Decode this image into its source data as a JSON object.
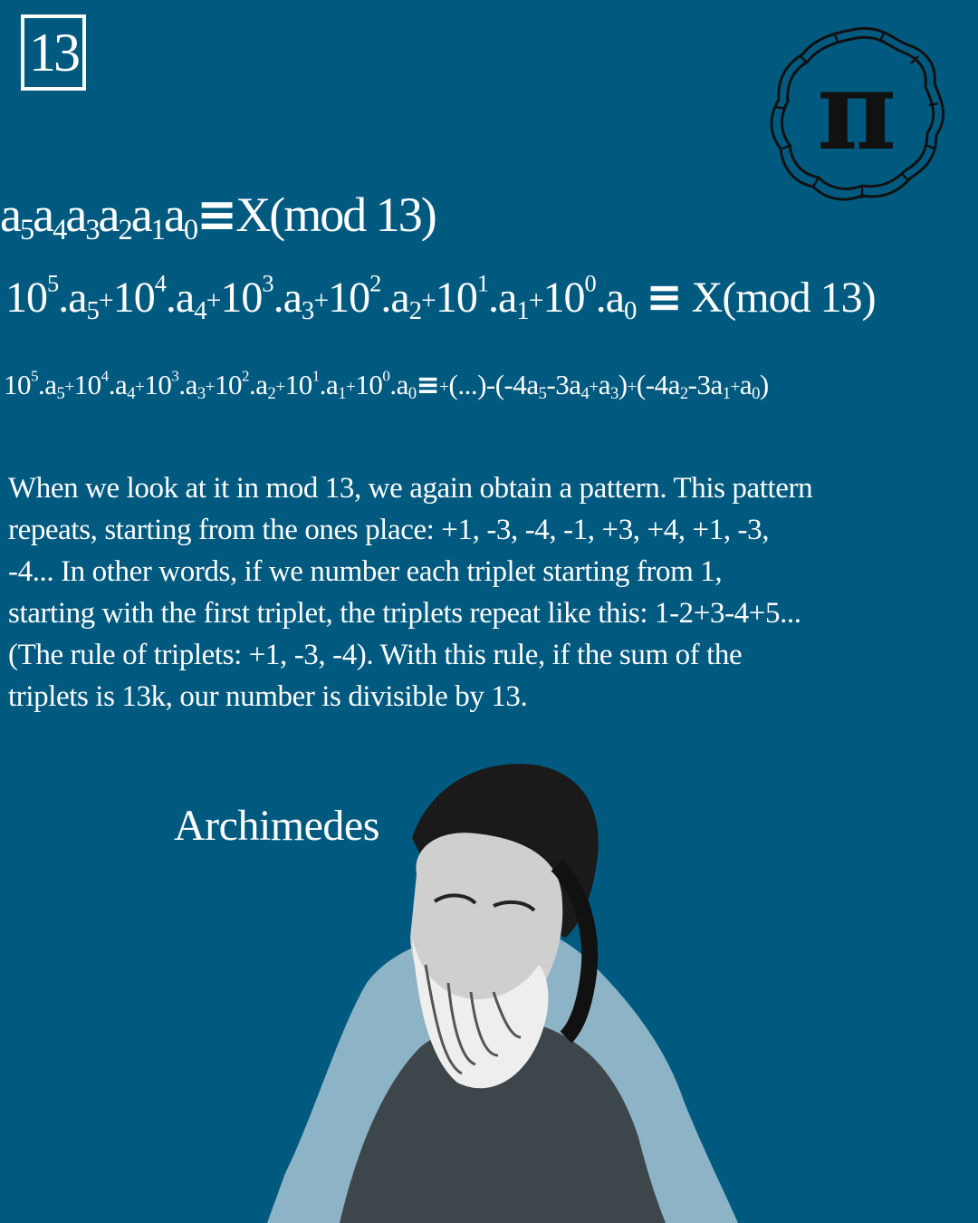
{
  "page_number": "13",
  "logo_symbol": "π",
  "formula1": {
    "a5": "a",
    "s5": "5",
    "a4": "a",
    "s4": "4",
    "a3": "a",
    "s3": "3",
    "a2": "a",
    "s2": "2",
    "a1": "a",
    "s1": "1",
    "a0": "a",
    "s0": "0",
    "eq": "≡",
    "rhs": "X(mod 13)"
  },
  "formula2": {
    "t5": "10",
    "e5": "5",
    "m5": ".a",
    "i5": "5",
    "p5": "+",
    "t4": "10",
    "e4": "4",
    "m4": ".a",
    "i4": "4",
    "p4": "+",
    "t3": "10",
    "e3": "3",
    "m3": ".a",
    "i3": "3",
    "p3": "+",
    "t2": "10",
    "e2": "2",
    "m2": ".a",
    "i2": "2",
    "p2": "+",
    "t1": "10",
    "e1": "1",
    "m1": ".a",
    "i1": "1",
    "p1": "+",
    "t0": "10",
    "e0": "0",
    "m0": ".a",
    "i0": "0",
    "eq": "≡",
    "rhs": "X(mod 13)"
  },
  "formula3": {
    "t5": "10",
    "e5": "5",
    "m5": ".a",
    "i5": "5",
    "p5": "+",
    "t4": "10",
    "e4": "4",
    "m4": ".a",
    "i4": "4",
    "p4": "+",
    "t3": "10",
    "e3": "3",
    "m3": ".a",
    "i3": "3",
    "p3": "+",
    "t2": "10",
    "e2": "2",
    "m2": ".a",
    "i2": "2",
    "p2": "+",
    "t1": "10",
    "e1": "1",
    "m1": ".a",
    "i1": "1",
    "p1": "+",
    "t0": "10",
    "e0": "0",
    "m0": ".a",
    "i0": "0",
    "eq": "≡",
    "r_plus1": "+",
    "r_part1": "(...)-(-4a",
    "r_s1": "5",
    "r_part2": "-3a",
    "r_s2": "4",
    "r_plus2": "+",
    "r_part3": "a",
    "r_s3": "3",
    "r_part4": ")",
    "r_plus3": "+",
    "r_part5": "(-4a",
    "r_s5": "2",
    "r_part6": "-3a",
    "r_s6": "1",
    "r_plus4": "+",
    "r_part7": "a",
    "r_s7": "0",
    "r_part8": ")"
  },
  "paragraph": "When we look at it in mod 13, we again obtain a pattern. This pattern repeats, starting from the ones place: +1, -3, -4, -1, +3, +4, +1, -3, -4... In other words, if we number each triplet starting from 1, starting with the first triplet, the triplets repeat like this: 1-2+3-4+5... (The rule of triplets: +1, -3, -4). With this rule, if the sum of the triplets is 13k, our number is divisible by 13.",
  "caption": "Archimedes",
  "colors": {
    "background": "#005a80",
    "text": "#ffffff",
    "ink": "#111111"
  }
}
